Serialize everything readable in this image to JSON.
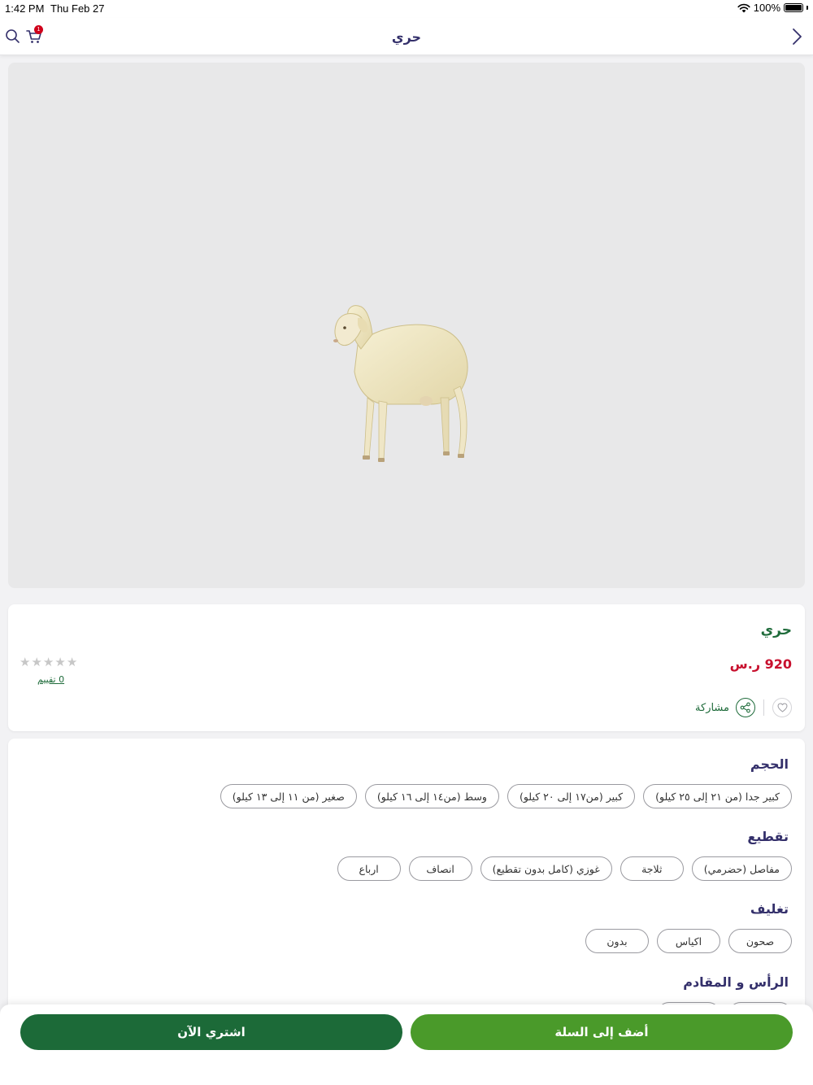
{
  "status_bar": {
    "time": "1:42 PM",
    "date": "Thu Feb 27",
    "battery": "100%"
  },
  "nav": {
    "title": "حري",
    "cart_count": "1",
    "icons": [
      "search-icon",
      "cart-icon",
      "chevron-right-icon"
    ]
  },
  "product": {
    "name": "حري",
    "price": "920 ر.س",
    "rating_stars": 5,
    "rating_value": 0,
    "rating_text": "0  تقييم",
    "share_label": "مشاركة"
  },
  "options": [
    {
      "title": "الحجم",
      "values": [
        "كبير جدا (من ٢١ إلى ٢٥ كيلو)",
        "كبير (من١٧ إلى ٢٠ كيلو)",
        "وسط (من١٤ إلى ١٦ كيلو)",
        "صغير (من ١١ إلى ١٣ كيلو)"
      ]
    },
    {
      "title": "تقطيع",
      "values": [
        "مفاصل (حضرمي)",
        "ثلاجة",
        "غوزي (كامل بدون تقطيع)",
        "انصاف",
        "ارباع"
      ]
    },
    {
      "title": "تغليف",
      "values": [
        "صحون",
        "اكياس",
        "بدون"
      ]
    },
    {
      "title": "الرأس و المقادم",
      "values": [
        "",
        ""
      ]
    }
  ],
  "buttons": {
    "add_to_cart": "أضف إلى السلة",
    "buy_now": "اشتري الآن"
  },
  "colors": {
    "brand_green": "#1c6a38",
    "light_green": "#4a9a2a",
    "price_red": "#c8102e",
    "title_purple": "#34306b"
  }
}
